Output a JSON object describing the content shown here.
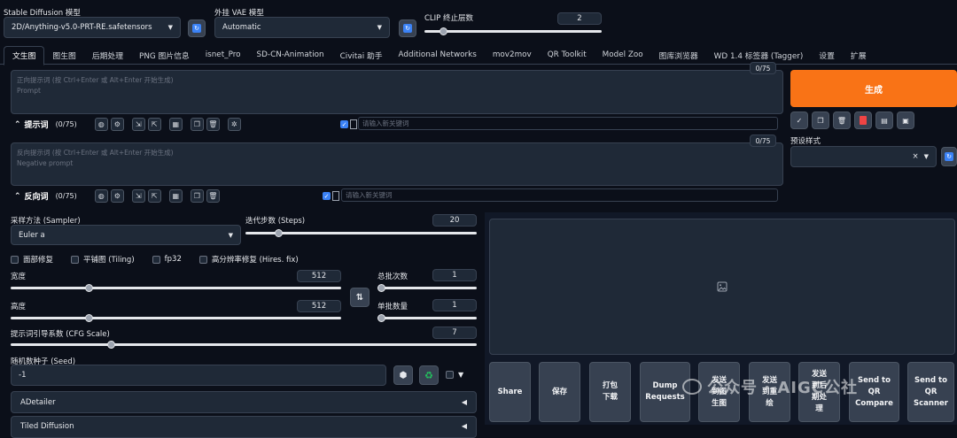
{
  "header": {
    "sd_model": {
      "label": "Stable Diffusion 模型",
      "value": "2D/Anything-v5.0-PRT-RE.safetensors"
    },
    "vae": {
      "label": "外挂 VAE 模型",
      "value": "Automatic"
    },
    "clip": {
      "label": "CLIP 终止层数",
      "value": "2",
      "fraction": 0.09
    }
  },
  "tabs": [
    "文生图",
    "图生图",
    "后期处理",
    "PNG 图片信息",
    "isnet_Pro",
    "SD-CN-Animation",
    "Civitai 助手",
    "Additional Networks",
    "mov2mov",
    "QR Toolkit",
    "Model Zoo",
    "图库浏览器",
    "WD 1.4 标签器 (Tagger)",
    "设置",
    "扩展"
  ],
  "prompt": {
    "counter": "0/75",
    "placeholder_line1": "正向提示词 (按 Ctrl+Enter 或 Alt+Enter 开始生成)",
    "placeholder_line2": "Prompt",
    "toolbar_title": "提示词",
    "toolbar_count": "(0/75)",
    "keyword_placeholder": "请输入新关键词"
  },
  "negative": {
    "counter": "0/75",
    "placeholder_line1": "反向提示词 (按 Ctrl+Enter 或 Alt+Enter 开始生成)",
    "placeholder_line2": "Negative prompt",
    "toolbar_title": "反向词",
    "toolbar_count": "(0/75)",
    "keyword_placeholder": "请输入新关键词"
  },
  "generate": {
    "label": "生成",
    "color": "#f97316"
  },
  "styles": {
    "label": "预设样式",
    "clear": "×"
  },
  "sampler": {
    "label": "采样方法 (Sampler)",
    "value": "Euler a"
  },
  "steps": {
    "label": "迭代步数 (Steps)",
    "value": "20",
    "fraction": 0.13
  },
  "checkboxes": [
    "面部修复",
    "平铺图 (Tiling)",
    "fp32",
    "高分辨率修复 (Hires. fix)"
  ],
  "width": {
    "label": "宽度",
    "value": "512",
    "fraction": 0.23
  },
  "height": {
    "label": "高度",
    "value": "512",
    "fraction": 0.23
  },
  "batch_count": {
    "label": "总批次数",
    "value": "1",
    "fraction": 0.0
  },
  "batch_size": {
    "label": "单批数量",
    "value": "1",
    "fraction": 0.0
  },
  "cfg": {
    "label": "提示词引导系数 (CFG Scale)",
    "value": "7",
    "fraction": 0.21
  },
  "seed": {
    "label": "随机数种子 (Seed)",
    "value": "-1"
  },
  "accordions": [
    "ADetailer",
    "Tiled Diffusion"
  ],
  "actions": [
    "Share",
    "保存",
    "打包\n下载",
    "Dump\nRequests",
    "发送\n到图\n生图",
    "发送\n到重\n绘",
    "发送\n到后\n期处\n理",
    "Send to\nQR\nCompare",
    "Send to\nQR\nScanner"
  ],
  "watermark": "公众号 · AIGC公社",
  "icons": {
    "refresh": "refresh-icon",
    "swap": "swap-icon",
    "dice": "dice-icon",
    "recycle": "recycle-icon",
    "image": "image-placeholder-icon"
  }
}
